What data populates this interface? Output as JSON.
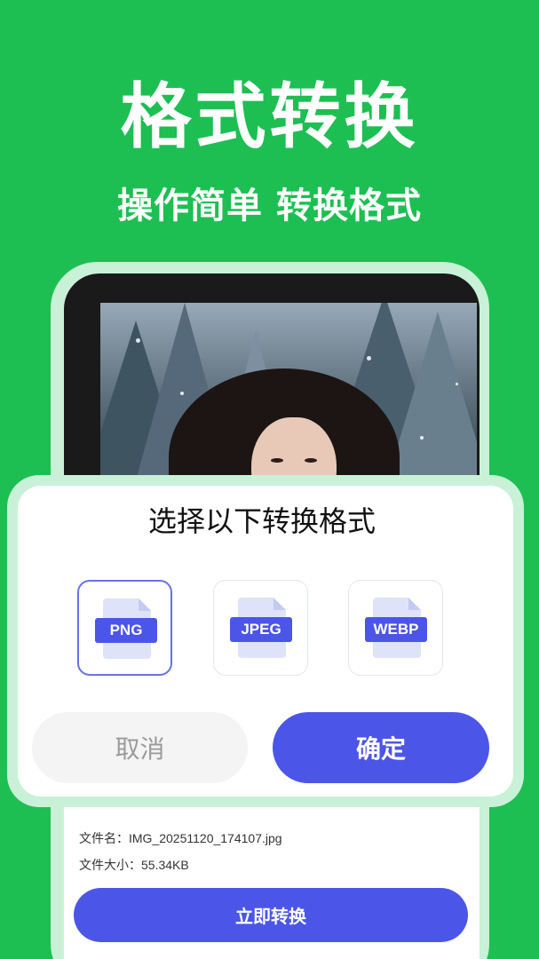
{
  "hero": {
    "title": "格式转换",
    "subtitle": "操作简单 转换格式"
  },
  "dialog": {
    "title": "选择以下转换格式",
    "formats": [
      {
        "label": "PNG",
        "selected": true
      },
      {
        "label": "JPEG",
        "selected": false
      },
      {
        "label": "WEBP",
        "selected": false
      }
    ],
    "cancel_label": "取消",
    "confirm_label": "确定"
  },
  "file_info": {
    "name_label": "文件名：",
    "name_value": "IMG_20251120_174107.jpg",
    "size_label": "文件大小：",
    "size_value": "55.34KB",
    "convert_label": "立即转换"
  },
  "colors": {
    "background": "#1dbf52",
    "accent": "#4b55e8",
    "selected_border": "#6673e6"
  }
}
